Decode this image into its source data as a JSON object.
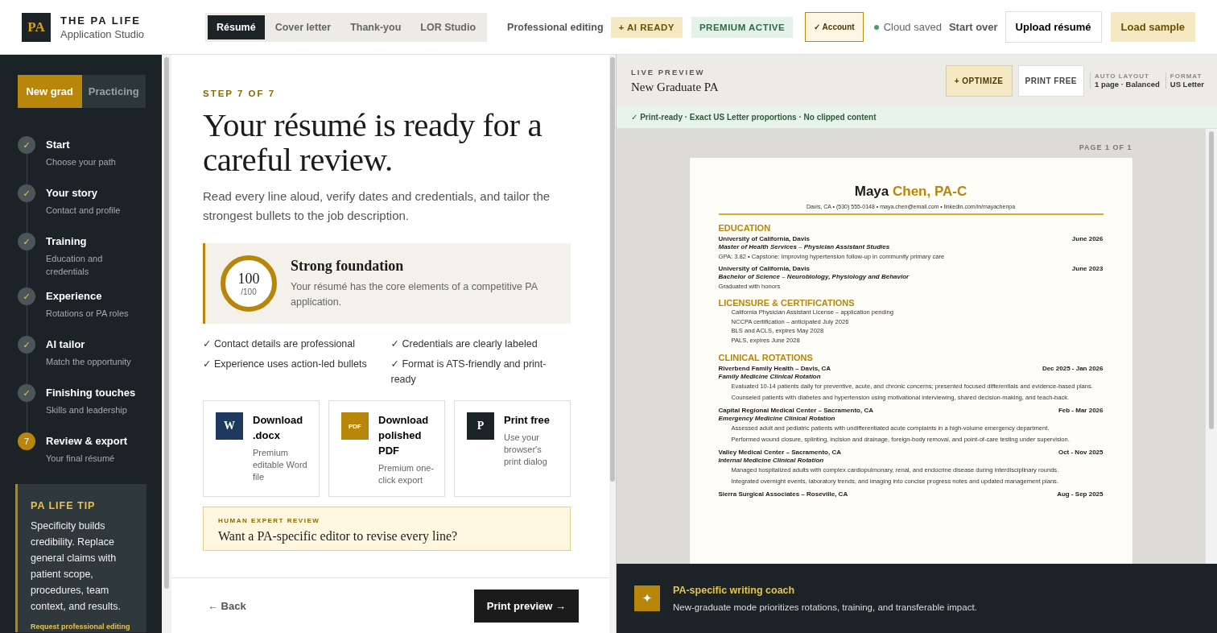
{
  "brand": {
    "logo": "PA",
    "name": "THE PA LIFE",
    "subtitle": "Application Studio"
  },
  "doc_tabs": [
    {
      "label": "Résumé",
      "selected": true
    },
    {
      "label": "Cover letter",
      "selected": false
    },
    {
      "label": "Thank-you",
      "selected": false
    },
    {
      "label": "LOR Studio",
      "selected": false
    }
  ],
  "header_actions": {
    "editing_link": "Professional editing",
    "ai_badge": "+ AI READY",
    "premium_badge": "PREMIUM ACTIVE",
    "account_button": "✓ Account",
    "save_status": "Cloud saved",
    "start_over": "Start over",
    "upload_button": "Upload résumé",
    "sample_button": "Load sample"
  },
  "mode_toggle": [
    {
      "label": "New grad",
      "selected": true
    },
    {
      "label": "Practicing",
      "selected": false
    }
  ],
  "steps": [
    {
      "marker": "✓",
      "title": "Start",
      "subtitle": "Choose your path",
      "done": true
    },
    {
      "marker": "✓",
      "title": "Your story",
      "subtitle": "Contact and profile",
      "done": true
    },
    {
      "marker": "✓",
      "title": "Training",
      "subtitle": "Education and credentials",
      "done": true
    },
    {
      "marker": "✓",
      "title": "Experience",
      "subtitle": "Rotations or PA roles",
      "done": true
    },
    {
      "marker": "✓",
      "title": "AI tailor",
      "subtitle": "Match the opportunity",
      "done": true
    },
    {
      "marker": "✓",
      "title": "Finishing touches",
      "subtitle": "Skills and leadership",
      "done": true
    },
    {
      "marker": "7",
      "title": "Review & export",
      "subtitle": "Your final résumé",
      "done": false
    }
  ],
  "tip": {
    "title": "PA LIFE TIP",
    "body": "Specificity builds credibility. Replace general claims with patient scope, procedures, team context, and results.",
    "link": "Request professional editing"
  },
  "review": {
    "step": "STEP 7 OF 7",
    "heading": "Your résumé is ready for a careful review.",
    "intro": "Read every line aloud, verify dates and credentials, and tailor the strongest bullets to the job description.",
    "score": {
      "value": "100",
      "max": "/100",
      "level": 1,
      "title": "Strong foundation",
      "text": "Your résumé has the core elements of a competitive PA application."
    },
    "checks": [
      "✓ Contact details are professional",
      "✓ Credentials are clearly labeled",
      "✓ Experience uses action-led bullets",
      "✓ Format is ATS-friendly and print-ready"
    ],
    "exports": [
      {
        "kind": "word",
        "badge": "W",
        "title": "Download .docx",
        "text": "Premium editable Word file"
      },
      {
        "kind": "pdf",
        "badge": "PDF",
        "title": "Download polished PDF",
        "text": "Premium one-click export"
      },
      {
        "kind": "print",
        "badge": "P",
        "title": "Print free",
        "text": "Use your browser's print dialog"
      }
    ],
    "expert": {
      "eyebrow": "HUMAN EXPERT REVIEW",
      "heading": "Want a PA-specific editor to revise every line?"
    }
  },
  "footer": {
    "back": "← Back",
    "next": "Print preview →"
  },
  "preview": {
    "eyebrow": "LIVE PREVIEW",
    "title": "New Graduate PA",
    "optimize": "+ OPTIMIZE",
    "print": "PRINT FREE",
    "meta": [
      {
        "label": "AUTO LAYOUT",
        "value": "1 page · Balanced"
      },
      {
        "label": "FORMAT",
        "value": "US Letter"
      }
    ],
    "status": "✓ Print-ready · Exact US Letter proportions · No clipped content",
    "page": "PAGE 1 OF 1"
  },
  "resume": {
    "first_name": "Maya",
    "last_name": "Chen, PA-C",
    "contact": "Davis, CA • (530) 555-0148 • maya.chen@email.com • linkedin.com/in/mayachenpa",
    "sections": [
      {
        "title": "EDUCATION",
        "entries": [
          {
            "org": "University of California, Davis",
            "date": "June 2026",
            "role": "Master of Health Services – Physician Assistant Studies",
            "details": [
              "GPA: 3.82 • Capstone: Improving hypertension follow-up in community primary care"
            ]
          },
          {
            "org": "University of California, Davis",
            "date": "June 2023",
            "role": "Bachelor of Science – Neurobiology, Physiology and Behavior",
            "details": [
              "Graduated with honors"
            ]
          }
        ]
      },
      {
        "title": "LICENSURE & CERTIFICATIONS",
        "items": [
          "California Physician Assistant License – application pending",
          "NCCPA certification – anticipated July 2026",
          "BLS and ACLS, expires May 2028",
          "PALS, expires June 2028"
        ]
      },
      {
        "title": "CLINICAL ROTATIONS",
        "entries": [
          {
            "org": "Riverbend Family Health – Davis, CA",
            "date": "Dec 2025 - Jan 2026",
            "role": "Family Medicine Clinical Rotation",
            "bullets": [
              "Evaluated 10-14 patients daily for preventive, acute, and chronic concerns; presented focused differentials and evidence-based plans.",
              "Counseled patients with diabetes and hypertension using motivational interviewing, shared decision-making, and teach-back."
            ]
          },
          {
            "org": "Capital Regional Medical Center – Sacramento, CA",
            "date": "Feb - Mar 2026",
            "role": "Emergency Medicine Clinical Rotation",
            "bullets": [
              "Assessed adult and pediatric patients with undifferentiated acute complaints in a high-volume emergency department.",
              "Performed wound closure, splinting, incision and drainage, foreign-body removal, and point-of-care testing under supervision."
            ]
          },
          {
            "org": "Valley Medical Center – Sacramento, CA",
            "date": "Oct - Nov 2025",
            "role": "Internal Medicine Clinical Rotation",
            "bullets": [
              "Managed hospitalized adults with complex cardiopulmonary, renal, and endocrine disease during interdisciplinary rounds.",
              "Integrated overnight events, laboratory trends, and imaging into concise progress notes and updated management plans."
            ]
          },
          {
            "org": "Sierra Surgical Associates – Roseville, CA",
            "date": "Aug - Sep 2025"
          }
        ]
      }
    ]
  },
  "coach": {
    "icon": "✦",
    "title": "PA-specific writing coach",
    "text": "New-graduate mode prioritizes rotations, training, and transferable impact."
  }
}
